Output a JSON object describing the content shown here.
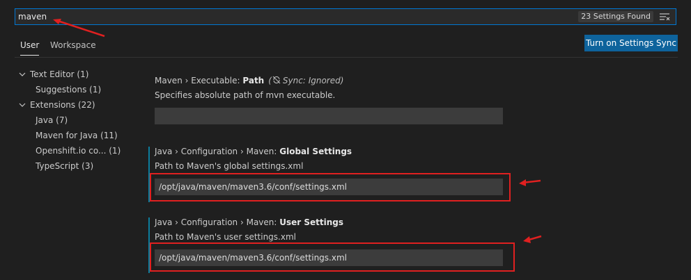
{
  "search": {
    "value": "maven",
    "results_label": "23 Settings Found",
    "clear_icon": "clear-filter-icon"
  },
  "tabs": [
    {
      "label": "User",
      "active": true
    },
    {
      "label": "Workspace",
      "active": false
    }
  ],
  "sync_button": {
    "label": "Turn on Settings Sync"
  },
  "toc": [
    {
      "label": "Text Editor (1)",
      "expanded": true,
      "level": 0
    },
    {
      "label": "Suggestions (1)",
      "level": 1
    },
    {
      "label": "Extensions (22)",
      "expanded": true,
      "level": 0
    },
    {
      "label": "Java (7)",
      "level": 1
    },
    {
      "label": "Maven for Java (11)",
      "level": 1
    },
    {
      "label": "Openshift.io co... (1)",
      "level": 1
    },
    {
      "label": "TypeScript (3)",
      "level": 1
    }
  ],
  "settings": [
    {
      "category": "Maven › Executable: ",
      "name": "Path",
      "sync_note": "Sync: Ignored)",
      "sync_note_prefix": "(",
      "description": "Specifies absolute path of mvn executable.",
      "value": ""
    },
    {
      "category": "Java › Configuration › Maven: ",
      "name": "Global Settings",
      "description": "Path to Maven's global settings.xml",
      "value": "/opt/java/maven/maven3.6/conf/settings.xml"
    },
    {
      "category": "Java › Configuration › Maven: ",
      "name": "User Settings",
      "description": "Path to Maven's user settings.xml",
      "value": "/opt/java/maven/maven3.6/conf/settings.xml"
    }
  ],
  "colors": {
    "background": "#1f1f1f",
    "accent": "#0078d4",
    "button": "#0e639c",
    "annotation": "#e02020",
    "modified_indicator": "#0c7d9d"
  }
}
